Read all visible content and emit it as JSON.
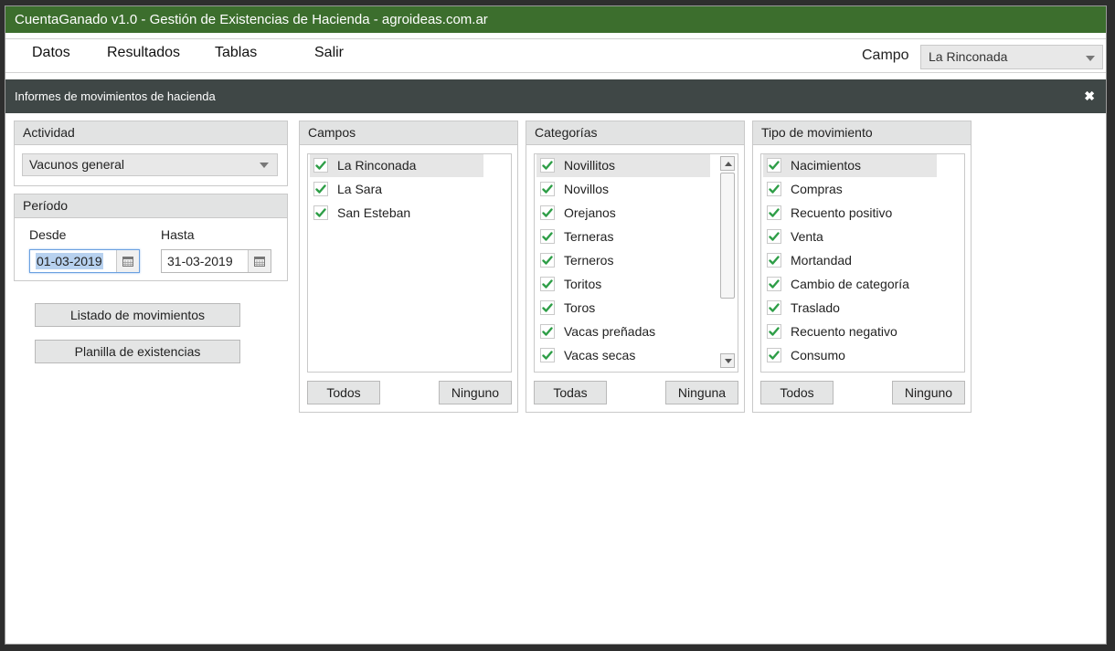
{
  "window": {
    "title": "CuentaGanado v1.0 - Gestión de Existencias de Hacienda - agroideas.com.ar"
  },
  "menu": {
    "items": [
      "Datos",
      "Resultados",
      "Tablas",
      "Salir"
    ],
    "campo_label": "Campo",
    "campo_value": "La Rinconada"
  },
  "dialog": {
    "title": "Informes de movimientos de hacienda"
  },
  "actividad": {
    "header": "Actividad",
    "value": "Vacunos general"
  },
  "periodo": {
    "header": "Período",
    "desde_label": "Desde",
    "hasta_label": "Hasta",
    "desde": "01-03-2019",
    "hasta": "31-03-2019"
  },
  "actions": {
    "listado": "Listado de movimientos",
    "planilla": "Planilla de existencias"
  },
  "campos": {
    "header": "Campos",
    "items": [
      "La Rinconada",
      "La Sara",
      "San Esteban"
    ],
    "all_label": "Todos",
    "none_label": "Ninguno"
  },
  "categorias": {
    "header": "Categorías",
    "items": [
      "Novillitos",
      "Novillos",
      "Orejanos",
      "Terneras",
      "Terneros",
      "Toritos",
      "Toros",
      "Vacas preñadas",
      "Vacas secas"
    ],
    "all_label": "Todas",
    "none_label": "Ninguna"
  },
  "tipos": {
    "header": "Tipo de movimiento",
    "items": [
      "Nacimientos",
      "Compras",
      "Recuento positivo",
      "Venta",
      "Mortandad",
      "Cambio de categoría",
      "Traslado",
      "Recuento negativo",
      "Consumo"
    ],
    "all_label": "Todos",
    "none_label": "Ninguno"
  },
  "colors": {
    "titlebar": "#3c6e2d",
    "dialog_header": "#3f4746",
    "check": "#2e9e47"
  }
}
